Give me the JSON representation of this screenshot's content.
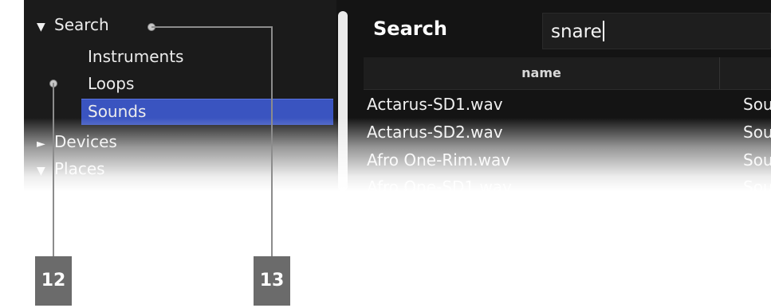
{
  "browser": {
    "tree": [
      {
        "label": "Search",
        "expanded": true
      },
      {
        "label": "Instruments"
      },
      {
        "label": "Loops"
      },
      {
        "label": "Sounds",
        "selected": true
      },
      {
        "label": "Devices",
        "expanded": false
      },
      {
        "label": "Places",
        "expanded": true
      }
    ],
    "tree_glyphs": {
      "expanded": "▼",
      "collapsed": "►"
    }
  },
  "search": {
    "label": "Search",
    "value": "snare"
  },
  "results": {
    "columns": [
      "name"
    ],
    "rows": [
      {
        "name": "Actarus-SD1.wav",
        "type": "Sou"
      },
      {
        "name": "Actarus-SD2.wav",
        "type": "Sou"
      },
      {
        "name": "Afro One-Rim.wav",
        "type": "Sou"
      },
      {
        "name": "Afro One-SD1.wav",
        "type": "Sou"
      }
    ]
  },
  "callouts": [
    {
      "number": "12"
    },
    {
      "number": "13"
    }
  ],
  "colors": {
    "selection": "#3a54c0",
    "panel": "#1b1b1b",
    "badge": "#6b6b6b"
  }
}
